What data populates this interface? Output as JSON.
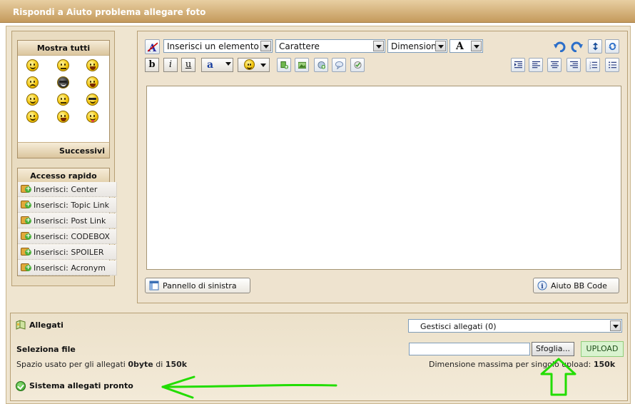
{
  "title": "Rispondi a Aiuto problema allegare foto",
  "smileys": {
    "header": "Mostra tutti",
    "next": "Successivi",
    "items": [
      "smile-icon",
      "wink-icon",
      "laugh-icon",
      "grin-icon",
      "cool-icon",
      "surprised-icon",
      "big-grin-icon",
      "confused-icon",
      "shades-icon",
      "happy-icon",
      "teeth-icon",
      "tongue-icon"
    ]
  },
  "quick_access": {
    "header": "Accesso rapido",
    "items": [
      "Inserisci: Center",
      "Inserisci: Topic Link",
      "Inserisci: Post Link",
      "Inserisci: CODEBOX",
      "Inserisci: SPOILER",
      "Inserisci: Acronym"
    ]
  },
  "toolbar": {
    "insert_element": "Inserisci un elemento",
    "font": "Carattere",
    "size": "Dimension",
    "font_color_label": "A",
    "bold": "b",
    "italic": "i",
    "underline": "u",
    "size2_label": "a"
  },
  "editor": {
    "left_panel_button": "Pannello di sinistra",
    "bbcode_help_button": "Aiuto BB Code"
  },
  "attachments": {
    "title": "Allegati",
    "manage": "Gestisci allegati (0)",
    "select_file": "Seleziona file",
    "browse": "Sfoglia...",
    "upload": "UPLOAD",
    "space_used_prefix": "Spazio usato per gli allegati",
    "space_used_value": "0byte",
    "space_of": "di",
    "space_total": "150k",
    "max_size_label": "Dimensione massima per singolo upload:",
    "max_size_value": "150k",
    "status": "Sistema allegati pronto"
  },
  "colors": {
    "title_bar": "#c49a5c",
    "panel": "#efe5d0",
    "annotation_arrow": "#22dd00"
  }
}
